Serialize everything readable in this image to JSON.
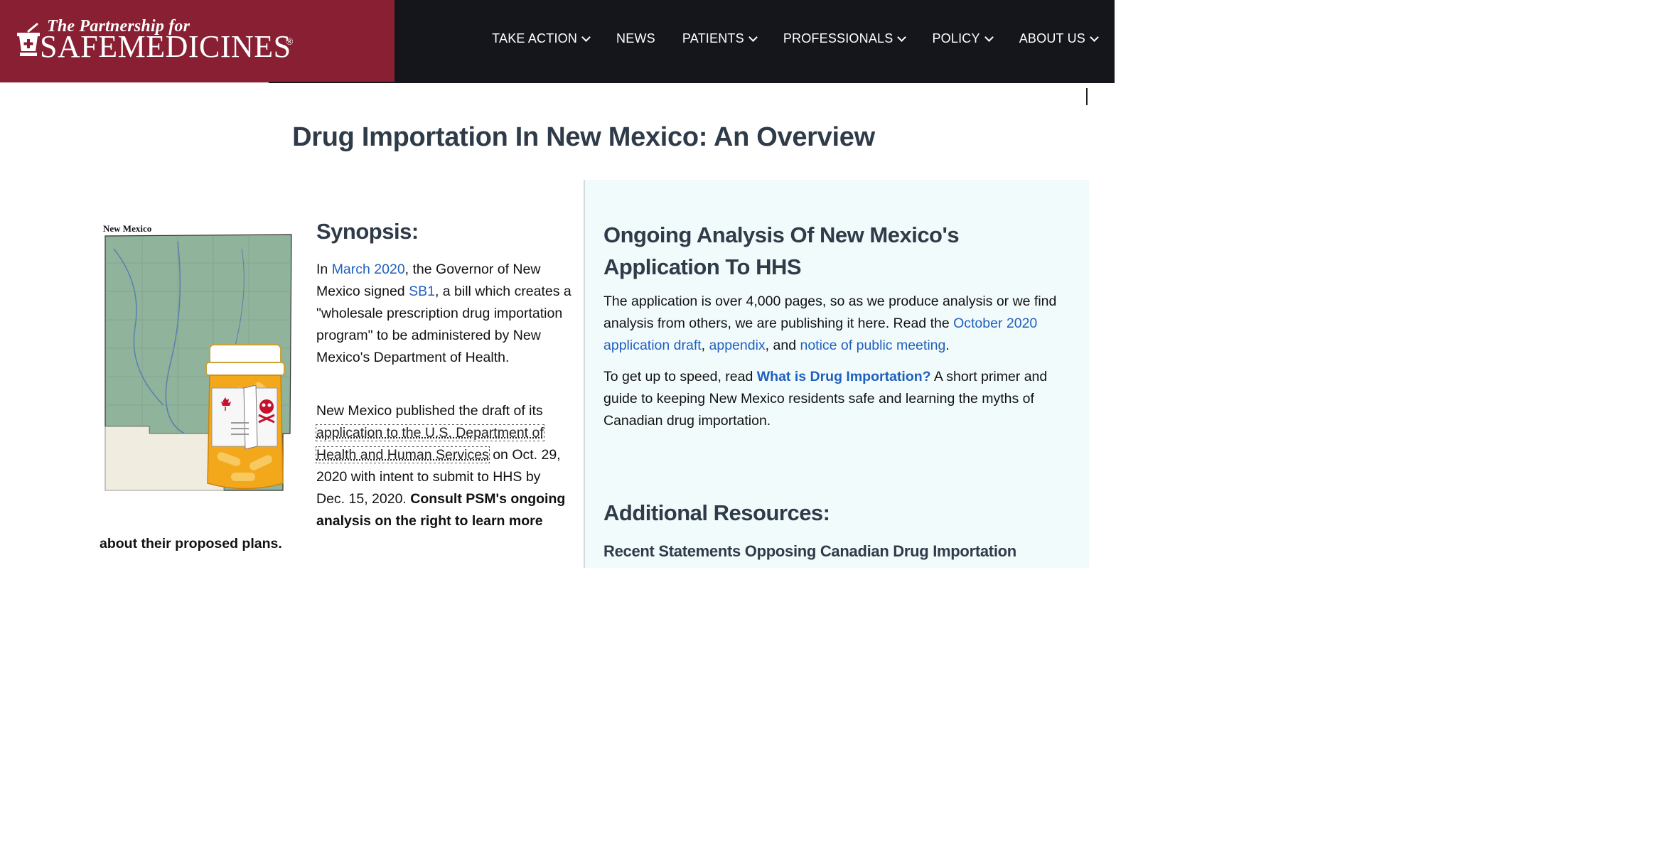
{
  "brand": {
    "tagline": "The Partnership for",
    "name": "SAFEMEDICINES",
    "registered": "®"
  },
  "nav": {
    "items": [
      {
        "label": "TAKE ACTION",
        "dropdown": true
      },
      {
        "label": "NEWS",
        "dropdown": false
      },
      {
        "label": "PATIENTS",
        "dropdown": true
      },
      {
        "label": "PROFESSIONALS",
        "dropdown": true
      },
      {
        "label": "POLICY",
        "dropdown": true
      },
      {
        "label": "ABOUT US",
        "dropdown": true
      }
    ]
  },
  "page": {
    "title": "Drug Importation In New Mexico: An Overview"
  },
  "synopsis": {
    "map_label": "New Mexico",
    "title": "Synopsis:",
    "p1": {
      "t1": "In ",
      "link1": "March 2020",
      "t2": ", the Governor of New Mexico signed ",
      "link2": "SB1",
      "t3": ", a bill which creates a \"wholesale prescription drug importation program\" to be administered by New Mexico's Department of Health."
    },
    "p2": {
      "t1": "New Mexico published the draft of its ",
      "link1": "application to the U.S. Department of Health and Human Services",
      "t2": " on Oct. 29, 2020 with intent to submit to HHS by Dec. 15, 2020. ",
      "bold": "Consult PSM's ongoing analysis on the right to learn more",
      "bold_tail": "about their proposed plans."
    }
  },
  "analysis": {
    "title": "Ongoing Analysis Of New Mexico's Application To HHS",
    "p1": {
      "t1": "The application is over 4,000 pages, so as we produce analysis or we find analysis from others, we are publishing it here. Read the ",
      "link1": "October 2020 application draft",
      "t2": ", ",
      "link2": "appendix",
      "t3": ", and ",
      "link3": "notice of public meeting",
      "t4": "."
    },
    "p2": {
      "t1": "To get up to speed, read ",
      "link1": "What is Drug Importation?",
      "t2": " A short primer and guide to keeping New Mexico residents safe and learning the myths of Canadian drug importation."
    },
    "resources_title": "Additional Resources:",
    "recent_title": "Recent Statements Opposing Canadian Drug Importation"
  },
  "colors": {
    "brand_red": "#881f32",
    "header_bg": "#15161c",
    "heading": "#2f3b49",
    "link": "#1f5fbf",
    "panel_bg": "#f2fbfb"
  }
}
